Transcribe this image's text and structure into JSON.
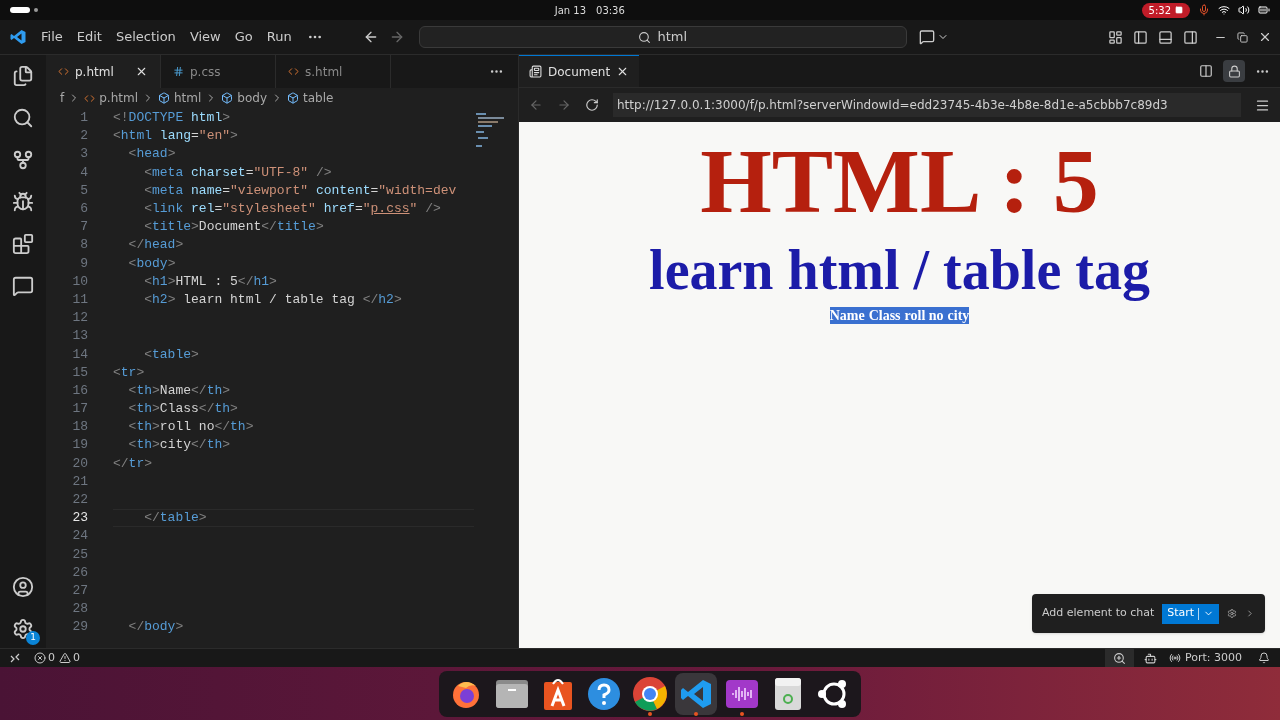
{
  "system_bar": {
    "date": "Jan 13",
    "time": "03:36",
    "recording": "5:32"
  },
  "menu": [
    "File",
    "Edit",
    "Selection",
    "View",
    "Go",
    "Run"
  ],
  "search": {
    "value": "html"
  },
  "editor_tabs": [
    {
      "label": "p.html",
      "kind": "html",
      "selected": true
    },
    {
      "label": "p.css",
      "kind": "css",
      "selected": false
    },
    {
      "label": "s.html",
      "kind": "html",
      "selected": false
    }
  ],
  "breadcrumb": [
    {
      "label": "f",
      "kind": "folder"
    },
    {
      "label": "p.html",
      "kind": "file"
    },
    {
      "label": "html",
      "kind": "element"
    },
    {
      "label": "body",
      "kind": "element"
    },
    {
      "label": "table",
      "kind": "element"
    }
  ],
  "code_lines": [
    {
      "number": "1",
      "current": false,
      "tokens": [
        {
          "kind": "punct",
          "text": "<!"
        },
        {
          "kind": "tag",
          "text": "DOCTYPE"
        },
        {
          "kind": "attr",
          "text": " html"
        },
        {
          "kind": "punct",
          "text": ">"
        }
      ]
    },
    {
      "number": "2",
      "current": false,
      "tokens": [
        {
          "kind": "punct",
          "text": "<"
        },
        {
          "kind": "tag",
          "text": "html"
        },
        {
          "kind": "attr",
          "text": " lang"
        },
        {
          "kind": "plain",
          "text": "="
        },
        {
          "kind": "string",
          "text": "\"en\""
        },
        {
          "kind": "punct",
          "text": ">"
        }
      ]
    },
    {
      "number": "3",
      "current": false,
      "tokens": [
        {
          "kind": "punct",
          "text": "  <"
        },
        {
          "kind": "tag",
          "text": "head"
        },
        {
          "kind": "punct",
          "text": ">"
        }
      ]
    },
    {
      "number": "4",
      "current": false,
      "tokens": [
        {
          "kind": "punct",
          "text": "    <"
        },
        {
          "kind": "tag",
          "text": "meta"
        },
        {
          "kind": "attr",
          "text": " charset"
        },
        {
          "kind": "plain",
          "text": "="
        },
        {
          "kind": "string",
          "text": "\"UTF-8\""
        },
        {
          "kind": "punct",
          "text": " />"
        }
      ]
    },
    {
      "number": "5",
      "current": false,
      "tokens": [
        {
          "kind": "punct",
          "text": "    <"
        },
        {
          "kind": "tag",
          "text": "meta"
        },
        {
          "kind": "attr",
          "text": " name"
        },
        {
          "kind": "plain",
          "text": "="
        },
        {
          "kind": "string",
          "text": "\"viewport\""
        },
        {
          "kind": "attr",
          "text": " content"
        },
        {
          "kind": "plain",
          "text": "="
        },
        {
          "kind": "string",
          "text": "\"width=dev"
        }
      ]
    },
    {
      "number": "6",
      "current": false,
      "tokens": [
        {
          "kind": "punct",
          "text": "    <"
        },
        {
          "kind": "tag",
          "text": "link"
        },
        {
          "kind": "attr",
          "text": " rel"
        },
        {
          "kind": "plain",
          "text": "="
        },
        {
          "kind": "string",
          "text": "\"stylesheet\""
        },
        {
          "kind": "attr",
          "text": " href"
        },
        {
          "kind": "plain",
          "text": "="
        },
        {
          "kind": "string",
          "text": "\""
        },
        {
          "kind": "link",
          "text": "p.css"
        },
        {
          "kind": "string",
          "text": "\""
        },
        {
          "kind": "punct",
          "text": " />"
        }
      ]
    },
    {
      "number": "7",
      "current": false,
      "tokens": [
        {
          "kind": "punct",
          "text": "    <"
        },
        {
          "kind": "tag",
          "text": "title"
        },
        {
          "kind": "punct",
          "text": ">"
        },
        {
          "kind": "plain",
          "text": "Document"
        },
        {
          "kind": "punct",
          "text": "</"
        },
        {
          "kind": "tag",
          "text": "title"
        },
        {
          "kind": "punct",
          "text": ">"
        }
      ]
    },
    {
      "number": "8",
      "current": false,
      "tokens": [
        {
          "kind": "punct",
          "text": "  </"
        },
        {
          "kind": "tag",
          "text": "head"
        },
        {
          "kind": "punct",
          "text": ">"
        }
      ]
    },
    {
      "number": "9",
      "current": false,
      "tokens": [
        {
          "kind": "punct",
          "text": "  <"
        },
        {
          "kind": "tag",
          "text": "body"
        },
        {
          "kind": "punct",
          "text": ">"
        }
      ]
    },
    {
      "number": "10",
      "current": false,
      "tokens": [
        {
          "kind": "punct",
          "text": "    <"
        },
        {
          "kind": "tag",
          "text": "h1"
        },
        {
          "kind": "punct",
          "text": ">"
        },
        {
          "kind": "plain",
          "text": "HTML : 5"
        },
        {
          "kind": "punct",
          "text": "</"
        },
        {
          "kind": "tag",
          "text": "h1"
        },
        {
          "kind": "punct",
          "text": ">"
        }
      ]
    },
    {
      "number": "11",
      "current": false,
      "tokens": [
        {
          "kind": "punct",
          "text": "    <"
        },
        {
          "kind": "tag",
          "text": "h2"
        },
        {
          "kind": "punct",
          "text": ">"
        },
        {
          "kind": "plain",
          "text": " learn html / table tag "
        },
        {
          "kind": "punct",
          "text": "</"
        },
        {
          "kind": "tag",
          "text": "h2"
        },
        {
          "kind": "punct",
          "text": ">"
        }
      ]
    },
    {
      "number": "12",
      "current": false
    },
    {
      "number": "13",
      "current": false
    },
    {
      "number": "14",
      "current": false,
      "tokens": [
        {
          "kind": "punct",
          "text": "    <"
        },
        {
          "kind": "tag",
          "text": "table"
        },
        {
          "kind": "punct",
          "text": ">"
        }
      ]
    },
    {
      "number": "15",
      "current": false,
      "tokens": [
        {
          "kind": "punct",
          "text": "<"
        },
        {
          "kind": "tag",
          "text": "tr"
        },
        {
          "kind": "punct",
          "text": ">"
        }
      ]
    },
    {
      "number": "16",
      "current": false,
      "tokens": [
        {
          "kind": "punct",
          "text": "  <"
        },
        {
          "kind": "tag",
          "text": "th"
        },
        {
          "kind": "punct",
          "text": ">"
        },
        {
          "kind": "plain",
          "text": "Name"
        },
        {
          "kind": "punct",
          "text": "</"
        },
        {
          "kind": "tag",
          "text": "th"
        },
        {
          "kind": "punct",
          "text": ">"
        }
      ]
    },
    {
      "number": "17",
      "current": false,
      "tokens": [
        {
          "kind": "punct",
          "text": "  <"
        },
        {
          "kind": "tag",
          "text": "th"
        },
        {
          "kind": "punct",
          "text": ">"
        },
        {
          "kind": "plain",
          "text": "Class"
        },
        {
          "kind": "punct",
          "text": "</"
        },
        {
          "kind": "tag",
          "text": "th"
        },
        {
          "kind": "punct",
          "text": ">"
        }
      ]
    },
    {
      "number": "18",
      "current": false,
      "tokens": [
        {
          "kind": "punct",
          "text": "  <"
        },
        {
          "kind": "tag",
          "text": "th"
        },
        {
          "kind": "punct",
          "text": ">"
        },
        {
          "kind": "plain",
          "text": "roll no"
        },
        {
          "kind": "punct",
          "text": "</"
        },
        {
          "kind": "tag",
          "text": "th"
        },
        {
          "kind": "punct",
          "text": ">"
        }
      ]
    },
    {
      "number": "19",
      "current": false,
      "tokens": [
        {
          "kind": "punct",
          "text": "  <"
        },
        {
          "kind": "tag",
          "text": "th"
        },
        {
          "kind": "punct",
          "text": ">"
        },
        {
          "kind": "plain",
          "text": "city"
        },
        {
          "kind": "punct",
          "text": "</"
        },
        {
          "kind": "tag",
          "text": "th"
        },
        {
          "kind": "punct",
          "text": ">"
        }
      ]
    },
    {
      "number": "20",
      "current": false,
      "tokens": [
        {
          "kind": "punct",
          "text": "</"
        },
        {
          "kind": "tag",
          "text": "tr"
        },
        {
          "kind": "punct",
          "text": ">"
        }
      ]
    },
    {
      "number": "21",
      "current": false
    },
    {
      "number": "22",
      "current": false
    },
    {
      "number": "23",
      "current": true,
      "tokens": [
        {
          "kind": "punct",
          "text": "    </"
        },
        {
          "kind": "tag",
          "text": "table"
        },
        {
          "kind": "punct",
          "text": ">"
        }
      ]
    },
    {
      "number": "24",
      "current": false
    },
    {
      "number": "25",
      "current": false
    },
    {
      "number": "26",
      "current": false
    },
    {
      "number": "27",
      "current": false
    },
    {
      "number": "28",
      "current": false
    },
    {
      "number": "29",
      "current": false,
      "tokens": [
        {
          "kind": "punct",
          "text": "  </"
        },
        {
          "kind": "tag",
          "text": "body"
        },
        {
          "kind": "punct",
          "text": ">"
        }
      ]
    }
  ],
  "preview": {
    "tab": "Document",
    "url": "http://127.0.0.1:3000/f/p.html?serverWindowId=edd23745-4b3e-4b8e-8d1e-a5cbbb7c89d3",
    "h1": "HTML : 5",
    "h2": "learn html / table tag",
    "table_headers": [
      "Name",
      "Class",
      "roll no",
      "city"
    ],
    "table_selected": true
  },
  "chat_popup": {
    "label": "Add element to chat",
    "button": "Start"
  },
  "settings_badge": "1",
  "status_bar": {
    "errors": "0",
    "warnings": "0",
    "port": "Port: 3000"
  },
  "dock": [
    {
      "kind": "fox",
      "running": false,
      "selected": false
    },
    {
      "kind": "folder",
      "running": false,
      "selected": false
    },
    {
      "kind": "store",
      "running": false,
      "selected": false
    },
    {
      "kind": "help",
      "running": false,
      "selected": false
    },
    {
      "kind": "chrome",
      "running": true,
      "selected": false
    },
    {
      "kind": "code",
      "running": true,
      "selected": true
    },
    {
      "kind": "sound",
      "running": true,
      "selected": false
    },
    {
      "kind": "trash",
      "running": false,
      "selected": false
    },
    {
      "kind": "ubuntu",
      "running": false,
      "selected": false
    }
  ]
}
